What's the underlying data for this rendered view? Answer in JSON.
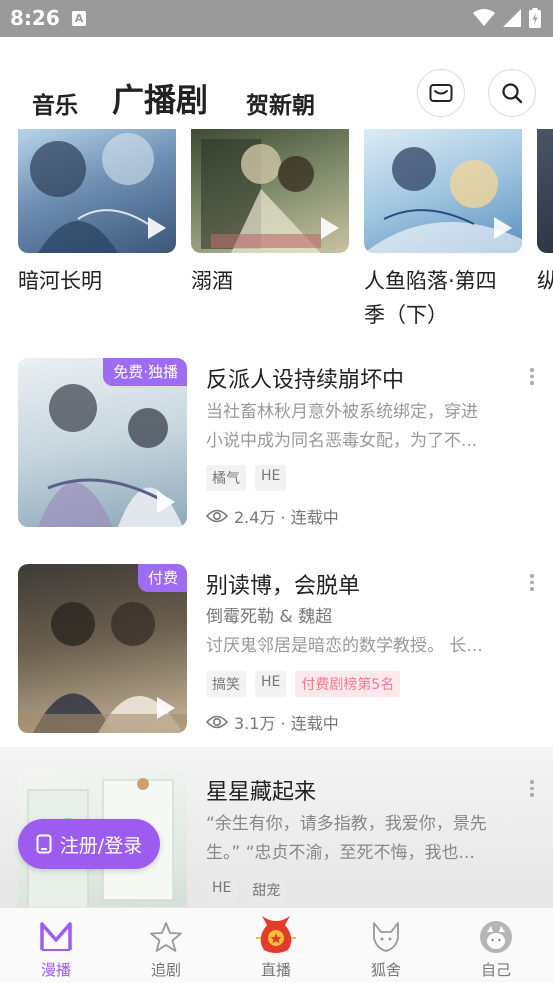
{
  "status_bar": {
    "time": "8:26",
    "notif_letter": "A"
  },
  "header": {
    "tabs": [
      {
        "label": "音乐"
      },
      {
        "label": "广播剧"
      },
      {
        "label": "贺新朝"
      }
    ],
    "active_tab": "广播剧",
    "icons": [
      "mail-icon",
      "search-icon"
    ]
  },
  "carousel": [
    {
      "title": "暗河长明"
    },
    {
      "title": "溺酒"
    },
    {
      "title": "人鱼陷落·第四季（下）",
      "title_line1": "人鱼陷落·第四",
      "title_line2": "季（下）"
    },
    {
      "title": "纵"
    }
  ],
  "list": [
    {
      "badge": "免费·独播",
      "title": "反派人设持续崩坏中",
      "desc_line1": "当社畜林秋月意外被系统绑定，穿进",
      "desc_line2": "小说中成为同名恶毒女配，为了不...",
      "tags": [
        "橘气",
        "HE"
      ],
      "views": "2.4万 · 连载中"
    },
    {
      "badge": "付费",
      "title": "别读博，会脱单",
      "author": "倒霉死勒 & 魏超",
      "desc_line1": "讨厌鬼邻居是暗恋的数学教授。 长...",
      "tags": [
        "搞笑",
        "HE"
      ],
      "rank_tag": "付费剧榜第5名",
      "views": "3.1万 · 连载中"
    },
    {
      "title": "星星藏起来",
      "desc_line1": "“余生有你，请多指教，我爱你，景先",
      "desc_line2": "生。” “忠贞不渝，至死不悔，我也...",
      "tags": [
        "HE",
        "甜宠"
      ]
    }
  ],
  "register_button": "注册/登录",
  "tab_bar": [
    {
      "label": "漫播",
      "icon": "m-logo-icon",
      "active": true
    },
    {
      "label": "追剧",
      "icon": "star-icon"
    },
    {
      "label": "直播",
      "icon": "lucky-bag-icon"
    },
    {
      "label": "狐舍",
      "icon": "fox-icon"
    },
    {
      "label": "自己",
      "icon": "avatar-icon"
    }
  ],
  "colors": {
    "accent": "#9d5cf0",
    "rank_tag": "#f07d8f",
    "status_bar": "#9a9a9a"
  }
}
